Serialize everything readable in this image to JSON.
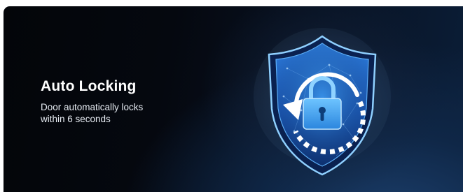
{
  "feature": {
    "title": "Auto Locking",
    "description_lines": [
      "Door automatically locks",
      "within 6 seconds"
    ]
  },
  "graphic": {
    "icon": "shield-lock-icon",
    "accent_color": "#2b78d8",
    "glow_color": "#9fd3ff"
  }
}
